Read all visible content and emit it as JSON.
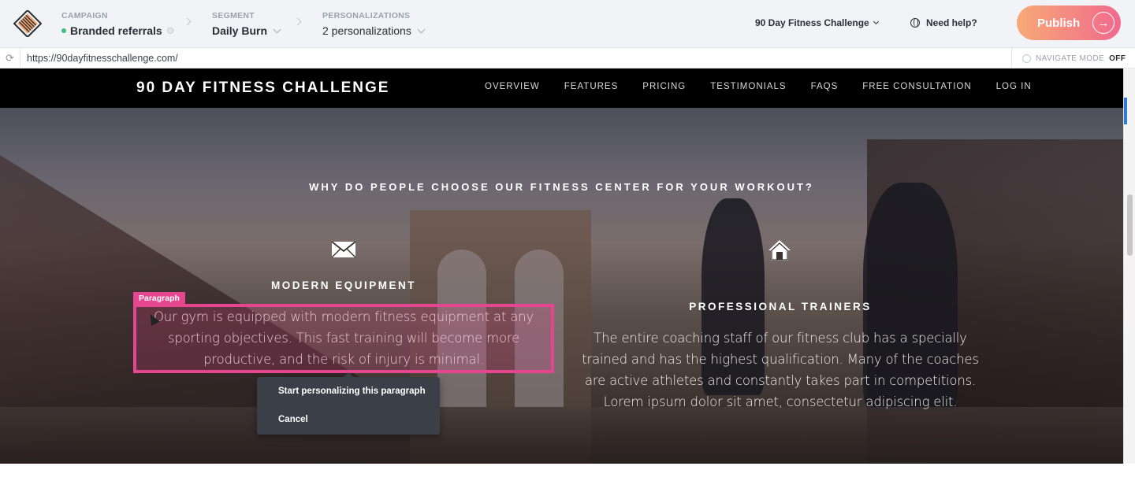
{
  "app": {
    "campaign": {
      "label": "CAMPAIGN",
      "value": "Branded referrals",
      "status_color": "#3cc07a"
    },
    "segment": {
      "label": "SEGMENT",
      "value": "Daily Burn"
    },
    "personalizations": {
      "label": "PERSONALIZATIONS",
      "value": "2 personalizations"
    },
    "site_selector": "90 Day Fitness Challenge",
    "help": "Need help?",
    "publish": "Publish",
    "accent_gradient": [
      "#f7a977",
      "#f06a8d"
    ]
  },
  "urlbar": {
    "url": "https://90dayfitnesschallenge.com/",
    "navigate_mode_label": "NAVIGATE MODE",
    "navigate_mode_value": "OFF"
  },
  "site": {
    "brand": "90 DAY FITNESS CHALLENGE",
    "nav": [
      "OVERVIEW",
      "FEATURES",
      "PRICING",
      "TESTIMONIALS",
      "FAQS",
      "FREE CONSULTATION",
      "LOG IN"
    ],
    "headline": "WHY DO PEOPLE CHOOSE OUR FITNESS CENTER FOR YOUR WORKOUT?",
    "features": [
      {
        "icon": "mail-icon",
        "title": "MODERN EQUIPMENT",
        "text": "Our gym is equipped with modern fitness equipment at any sporting objectives. This fast training will become more productive, and the risk of injury is minimal."
      },
      {
        "icon": "home-icon",
        "title": "PROFESSIONAL TRAINERS",
        "text": "The entire coaching staff of our fitness club has a specially trained and has the highest qualification. Many of the coaches are active athletes and constantly takes part in competitions. Lorem ipsum dolor sit amet, consectetur adipiscing elit."
      }
    ]
  },
  "selection": {
    "tag": "Paragraph",
    "color": "#e5468f",
    "menu": [
      "Start personalizing this paragraph",
      "Cancel"
    ]
  }
}
